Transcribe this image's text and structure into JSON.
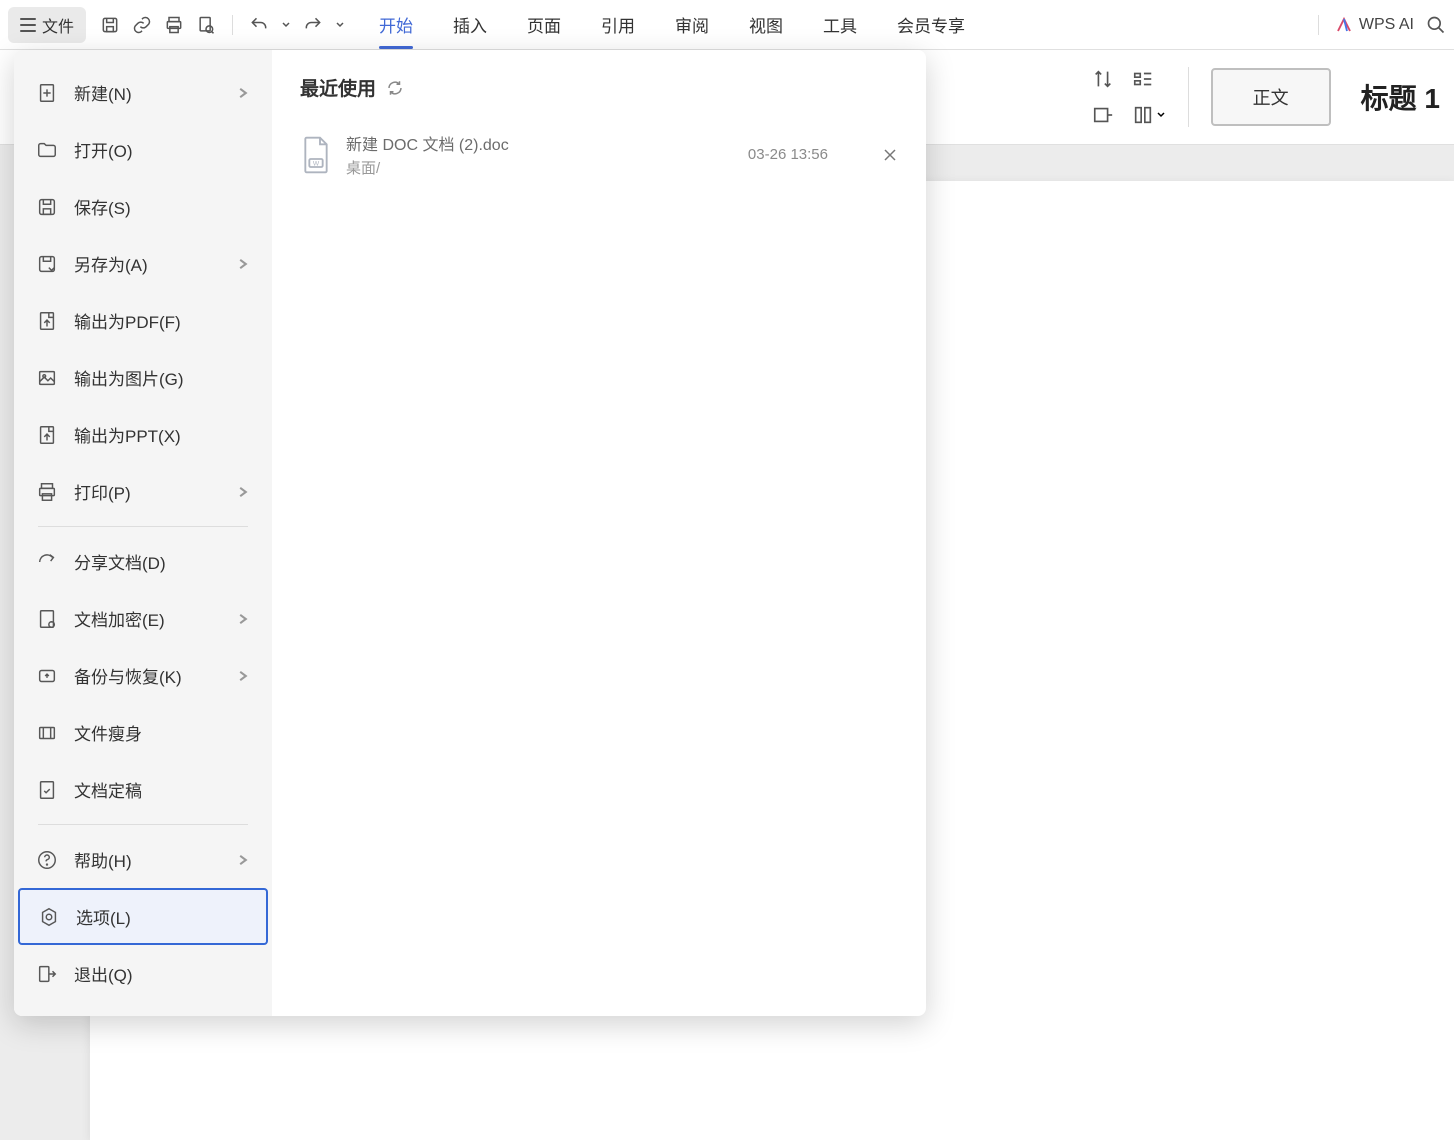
{
  "toolbar": {
    "file_label": "文件"
  },
  "tabs": {
    "start": "开始",
    "insert": "插入",
    "page": "页面",
    "reference": "引用",
    "review": "审阅",
    "view": "视图",
    "tools": "工具",
    "member": "会员专享",
    "wps_ai": "WPS AI"
  },
  "ribbon": {
    "style_normal": "正文",
    "style_heading": "标题 1"
  },
  "sidebar": {
    "new": "新建(N)",
    "open": "打开(O)",
    "save": "保存(S)",
    "save_as": "另存为(A)",
    "export_pdf": "输出为PDF(F)",
    "export_image": "输出为图片(G)",
    "export_ppt": "输出为PPT(X)",
    "print": "打印(P)",
    "share": "分享文档(D)",
    "encrypt": "文档加密(E)",
    "backup": "备份与恢复(K)",
    "slim": "文件瘦身",
    "finalize": "文档定稿",
    "help": "帮助(H)",
    "options": "选项(L)",
    "exit": "退出(Q)"
  },
  "recent": {
    "title": "最近使用",
    "items": [
      {
        "name": "新建 DOC 文档 (2).doc",
        "path": "桌面/",
        "time": "03-26 13:56"
      }
    ]
  }
}
